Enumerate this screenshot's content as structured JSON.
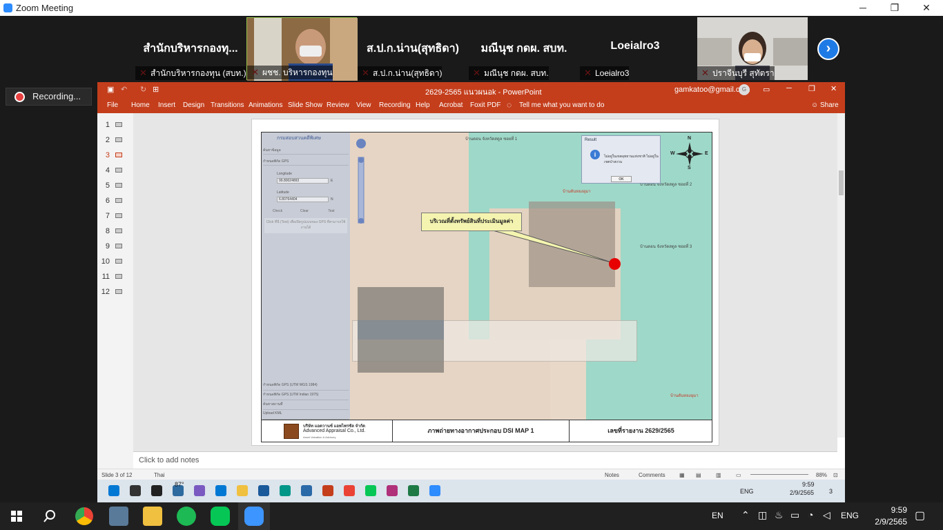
{
  "zoom": {
    "title": "Zoom Meeting",
    "recording_label": "Recording...",
    "window_controls": {
      "minimize": "─",
      "restore": "❐",
      "close": "✕"
    },
    "participants": [
      {
        "display": "สำนักบริหารกองทุ...",
        "name": "สำนักบริหารกองทุน (สบท.)",
        "video": false
      },
      {
        "display": "",
        "name": "ผชช. บริหารกองทุน",
        "video": true
      },
      {
        "display": "ส.ป.ก.น่าน(สุทธิดา)",
        "name": "ส.ป.ก.น่าน(สุทธิดา)",
        "video": false
      },
      {
        "display": "มณีนุช กดผ. สบท.",
        "name": "มณีนุช กดผ. สบท.",
        "video": false
      },
      {
        "display": "Loeialro3",
        "name": "Loeialro3",
        "video": false
      },
      {
        "display": "",
        "name": "ปราจีนบุรี สุทัตรา",
        "video": true
      }
    ],
    "next_arrow": "›"
  },
  "ppt": {
    "title": "2629-2565 แนวผนอk - PowerPoint",
    "account": "gamkatoo@gmail.com",
    "account_initial": "G",
    "share": "Share",
    "tell_me": "Tell me what you want to do",
    "ribbon_tabs": [
      "File",
      "Home",
      "Insert",
      "Design",
      "Transitions",
      "Animations",
      "Slide Show",
      "Review",
      "View",
      "Recording",
      "Help",
      "Acrobat",
      "Foxit PDF"
    ],
    "slides": [
      "1",
      "2",
      "3",
      "4",
      "5",
      "6",
      "7",
      "8",
      "9",
      "10",
      "11",
      "12"
    ],
    "current_slide_index": 2,
    "notes_placeholder": "Click to add notes",
    "status": {
      "slide_of": "Slide 3 of 12",
      "language": "Thai",
      "notes": "Notes",
      "comments": "Comments",
      "zoom": "88%"
    },
    "slide_content": {
      "map_panel": {
        "header": "กรมสอบสวนคดีพิเศษ",
        "row1": "ค้นหาข้อมูล",
        "row2": "กำหนดพิกัด GPS",
        "longitude_label": "Longitude",
        "longitude_value": "99.80024893",
        "longitude_unit": "E",
        "latitude_label": "Latitude",
        "latitude_value": "6.80764404",
        "latitude_unit": "N",
        "btn_check": "Check",
        "btn_clear": "Clear",
        "btn_test": "Test",
        "hint": "Click ที่นี่ (Test) เพื่อเปิดรูปแบบของ GPS ที่สามารถใช้งานได้",
        "bottom_rows": [
          "กำหนดพิกัด GPS (UTM WGS 1984)",
          "กำหนดพิกัด GPS (UTM Indian 1975)",
          "ค้นหาสถานที่",
          "Upload KML"
        ]
      },
      "callout_text": "บริเวณที่ตั้งทรัพย์สินที่ประเมินมูลค่า",
      "result_dialog": {
        "title": "Result",
        "message": "ไม่อยู่ในเขตอุทยานแห่งชาติ ไม่อยู่ในเขตป่าสงวน",
        "ok": "OK"
      },
      "compass": {
        "n": "N",
        "s": "S",
        "e": "E",
        "w": "W"
      },
      "map_labels": [
        "บ้านดอน จังหวัดสตูล ซอยที่ 1",
        "บ้านตันหยงอุมา",
        "บ้านดอน จังหวัดสตูล ซอยที่ 2",
        "บ้านดอน จังหวัดสตูล ซอยที่ 3",
        "บ้านตันหยงอุมา"
      ],
      "footer": {
        "company_th": "บริษัท แอดวานซ์ แอพไพรซัล จำกัด",
        "company_en": "Advanced Appraisal Co., Ltd.",
        "company_sub": "Asset Valuation & Advisory",
        "caption": "ภาพถ่ายทางอากาศประกอบ DSI MAP 1",
        "report_no": "เลขที่รายงาน 2629/2565"
      }
    }
  },
  "inner_taskbar": {
    "weather": "87°",
    "lang": "ENG",
    "time": "9:59",
    "date": "2/9/2565",
    "badge": "3"
  },
  "taskbar": {
    "lang_left": "EN",
    "lang_right": "ENG",
    "time": "9:59",
    "date": "2/9/2565"
  }
}
